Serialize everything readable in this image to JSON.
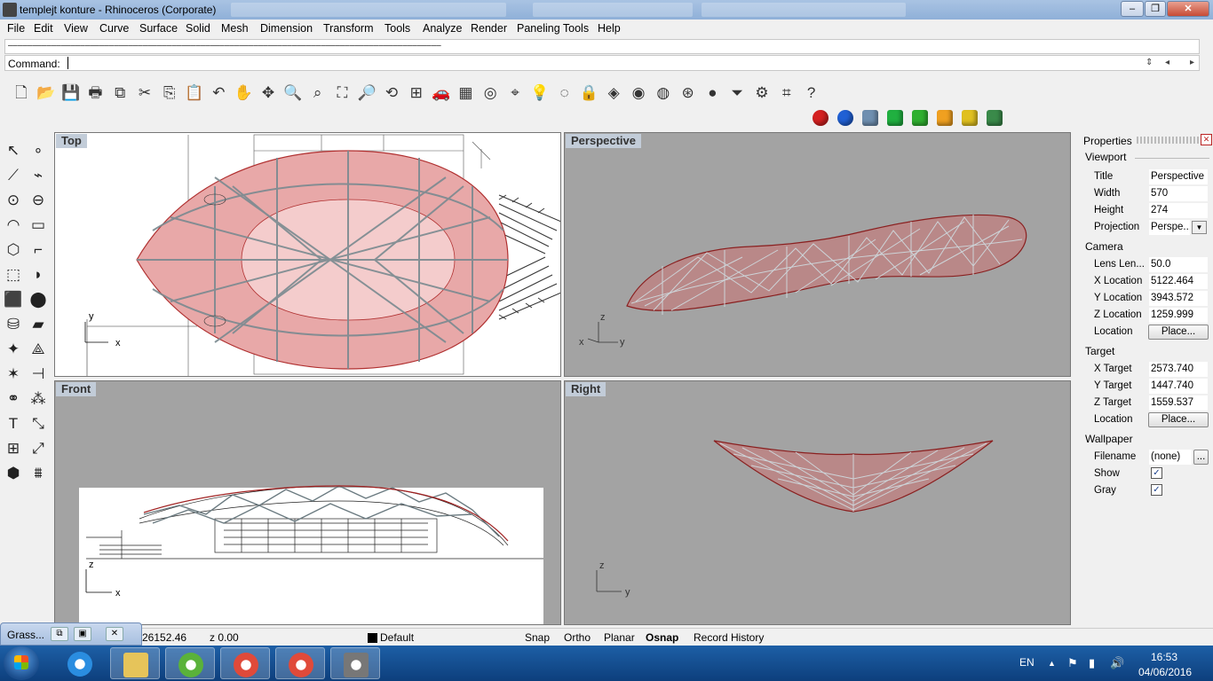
{
  "window": {
    "title": "templejt konture - Rhinoceros (Corporate)",
    "controls": {
      "minimize": "–",
      "maximize": "❐",
      "close": "✕"
    }
  },
  "menu": [
    "File",
    "Edit",
    "View",
    "Curve",
    "Surface",
    "Solid",
    "Mesh",
    "Dimension",
    "Transform",
    "Tools",
    "Analyze",
    "Render",
    "Paneling Tools",
    "Help"
  ],
  "command": {
    "history": "——————————————————————————————————————————————————————————————————————————————————————————",
    "label": "Command:",
    "value": ""
  },
  "toolbar_main": [
    {
      "icon": "new-file-icon",
      "glyph": "🗋"
    },
    {
      "icon": "open-folder-icon",
      "glyph": "📂"
    },
    {
      "icon": "save-icon",
      "glyph": "💾"
    },
    {
      "icon": "print-icon",
      "glyph": "🖶"
    },
    {
      "icon": "export-icon",
      "glyph": "⧉"
    },
    {
      "icon": "cut-icon",
      "glyph": "✂"
    },
    {
      "icon": "copy-icon",
      "glyph": "⎘"
    },
    {
      "icon": "paste-icon",
      "glyph": "📋"
    },
    {
      "icon": "undo-icon",
      "glyph": "↶"
    },
    {
      "icon": "pan-hand-icon",
      "glyph": "✋"
    },
    {
      "icon": "move-view-icon",
      "glyph": "✥"
    },
    {
      "icon": "zoom-dynamic-icon",
      "glyph": "🔍"
    },
    {
      "icon": "zoom-window-icon",
      "glyph": "⌕"
    },
    {
      "icon": "zoom-extents-icon",
      "glyph": "⛶"
    },
    {
      "icon": "zoom-selected-icon",
      "glyph": "🔎"
    },
    {
      "icon": "rotate-view-icon",
      "glyph": "⟲"
    },
    {
      "icon": "four-viewports-icon",
      "glyph": "⊞"
    },
    {
      "icon": "car-render-icon",
      "glyph": "🚗"
    },
    {
      "icon": "grid-options-icon",
      "glyph": "▦"
    },
    {
      "icon": "select-filter-icon",
      "glyph": "◎"
    },
    {
      "icon": "osnap-icon",
      "glyph": "⌖"
    },
    {
      "icon": "light-bulb-icon",
      "glyph": "💡"
    },
    {
      "icon": "light-icon",
      "glyph": "◌"
    },
    {
      "icon": "lock-icon",
      "glyph": "🔒"
    },
    {
      "icon": "layer-icon",
      "glyph": "◈"
    },
    {
      "icon": "color-wheel-icon",
      "glyph": "◉"
    },
    {
      "icon": "wireframe-sphere-icon",
      "glyph": "◍"
    },
    {
      "icon": "shaded-sphere-icon",
      "glyph": "⊛"
    },
    {
      "icon": "rendered-sphere-icon",
      "glyph": "●"
    },
    {
      "icon": "filter-icon",
      "glyph": "⏷"
    },
    {
      "icon": "options-gear-icon",
      "glyph": "⚙"
    },
    {
      "icon": "grasshopper-icon",
      "glyph": "⌗"
    },
    {
      "icon": "help-icon",
      "glyph": "?"
    }
  ],
  "toolbar_render": [
    {
      "icon": "red-material-sphere-icon",
      "color": "#d42020"
    },
    {
      "icon": "blue-material-sphere-icon",
      "color": "#2060d4"
    },
    {
      "icon": "box-mapping-icon",
      "color": "#6f8fb0"
    },
    {
      "icon": "green-gem-icon",
      "color": "#20b040"
    },
    {
      "icon": "green-cube-icon",
      "color": "#30b030"
    },
    {
      "icon": "orange-cone-icon",
      "color": "#f0a020"
    },
    {
      "icon": "yellow-frame-icon",
      "color": "#e0c020"
    },
    {
      "icon": "green-door-icon",
      "color": "#3a8a4a"
    }
  ],
  "toolbar_left": [
    {
      "icon": "select-arrow-icon",
      "glyph": "↖"
    },
    {
      "icon": "point-icon",
      "glyph": "∘"
    },
    {
      "icon": "polyline-icon",
      "glyph": "⟋"
    },
    {
      "icon": "curve-points-icon",
      "glyph": "⌁"
    },
    {
      "icon": "circle-icon",
      "glyph": "⊙"
    },
    {
      "icon": "circle-center-icon",
      "glyph": "⊖"
    },
    {
      "icon": "arc-icon",
      "glyph": "◠"
    },
    {
      "icon": "rectangle-icon",
      "glyph": "▭"
    },
    {
      "icon": "polygon-icon",
      "glyph": "⬡"
    },
    {
      "icon": "fillet-icon",
      "glyph": "⌐"
    },
    {
      "icon": "surface-points-icon",
      "glyph": "⬚"
    },
    {
      "icon": "revolve-icon",
      "glyph": "◗"
    },
    {
      "icon": "box-solid-icon",
      "glyph": "⬛"
    },
    {
      "icon": "sphere-solid-icon",
      "glyph": "⬤"
    },
    {
      "icon": "cylinder-solid-icon",
      "glyph": "⛁"
    },
    {
      "icon": "surface-patch-icon",
      "glyph": "▰"
    },
    {
      "icon": "boolean-union-icon",
      "glyph": "✦"
    },
    {
      "icon": "mesh-icon",
      "glyph": "⟁"
    },
    {
      "icon": "explode-icon",
      "glyph": "✶"
    },
    {
      "icon": "trim-icon",
      "glyph": "⊣"
    },
    {
      "icon": "join-icon",
      "glyph": "⚭"
    },
    {
      "icon": "array-icon",
      "glyph": "⁂"
    },
    {
      "icon": "text-icon",
      "glyph": "T"
    },
    {
      "icon": "dimension-icon",
      "glyph": "⤡"
    },
    {
      "icon": "group-icon",
      "glyph": "⊞"
    },
    {
      "icon": "transform-icon",
      "glyph": "⤢"
    },
    {
      "icon": "block-icon",
      "glyph": "⬢"
    },
    {
      "icon": "hatch-icon",
      "glyph": "⩩"
    }
  ],
  "viewports": {
    "top": {
      "title": "Top",
      "axes": {
        "a": "y",
        "b": "x"
      }
    },
    "persp": {
      "title": "Perspective",
      "axes": {
        "a": "z",
        "b": "x",
        "c": "y"
      }
    },
    "front": {
      "title": "Front",
      "axes": {
        "a": "z",
        "b": "x"
      }
    },
    "right": {
      "title": "Right",
      "axes": {
        "a": "z",
        "b": "y"
      }
    }
  },
  "properties": {
    "title": "Properties",
    "close": "✕",
    "viewport_head": "Viewport",
    "title_label": "Title",
    "title_value": "Perspective",
    "width_label": "Width",
    "width_value": "570",
    "height_label": "Height",
    "height_value": "274",
    "projection_label": "Projection",
    "projection_value": "Perspe...",
    "camera_head": "Camera",
    "lens_label": "Lens Len...",
    "lens_value": "50.0",
    "xloc_label": "X Location",
    "xloc_value": "5122.464",
    "yloc_label": "Y Location",
    "yloc_value": "3943.572",
    "zloc_label": "Z Location",
    "zloc_value": "1259.999",
    "cam_location_label": "Location",
    "cam_place": "Place...",
    "target_head": "Target",
    "xtar_label": "X Target",
    "xtar_value": "2573.740",
    "ytar_label": "Y Target",
    "ytar_value": "1447.740",
    "ztar_label": "Z Target",
    "ztar_value": "1559.537",
    "tar_location_label": "Location",
    "tar_place": "Place...",
    "wallpaper_head": "Wallpaper",
    "filename_label": "Filename",
    "filename_value": "(none)",
    "filename_btn": "...",
    "show_label": "Show",
    "show_check": "✓",
    "gray_label": "Gray",
    "gray_check": "✓"
  },
  "status": {
    "coord_y": "26152.46",
    "coord_z": "z 0.00",
    "layer": "Default",
    "snap": "Snap",
    "ortho": "Ortho",
    "planar": "Planar",
    "osnap": "Osnap",
    "record": "Record History"
  },
  "grasshopper": {
    "label": "Grass...",
    "restore": "⧉",
    "maximize": "▣",
    "close": "✕"
  },
  "taskbar": {
    "apps": [
      {
        "name": "internet-explorer",
        "color": "#2a8de0"
      },
      {
        "name": "file-explorer",
        "color": "#e6c45a"
      },
      {
        "name": "utorrent",
        "color": "#5ab23a"
      },
      {
        "name": "chrome",
        "color": "#e04a3a"
      },
      {
        "name": "chrome-2",
        "color": "#e04a3a"
      },
      {
        "name": "rhinoceros",
        "color": "#777777"
      }
    ],
    "lang": "EN",
    "tray_up": "▲",
    "tray_flag": "⚑",
    "tray_network": "▮",
    "tray_volume": "🔊",
    "time": "16:53",
    "date": "04/06/2016"
  }
}
